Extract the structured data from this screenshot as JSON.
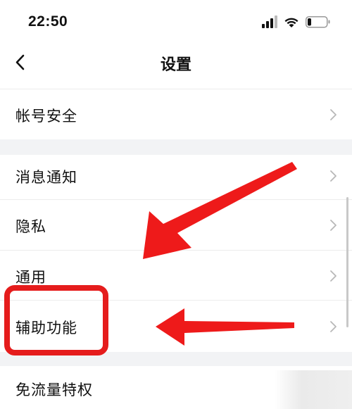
{
  "status_bar": {
    "time": "22:50",
    "icons": [
      "signal-icon",
      "wifi-icon",
      "battery-icon"
    ]
  },
  "nav": {
    "title": "设置",
    "back_icon": "chevron-left-icon"
  },
  "settings": {
    "items": [
      {
        "label": "帐号安全"
      },
      {
        "label": "消息通知"
      },
      {
        "label": "隐私"
      },
      {
        "label": "通用"
      },
      {
        "label": "辅助功能"
      },
      {
        "label": "免流量特权"
      }
    ]
  },
  "annotations": {
    "highlight_color": "#e51c1c",
    "arrow_color": "#ee1a1a"
  },
  "colors": {
    "background": "#ffffff",
    "section_gap": "#f2f3f5",
    "text": "#111111",
    "chevron": "#b8b8b8"
  }
}
